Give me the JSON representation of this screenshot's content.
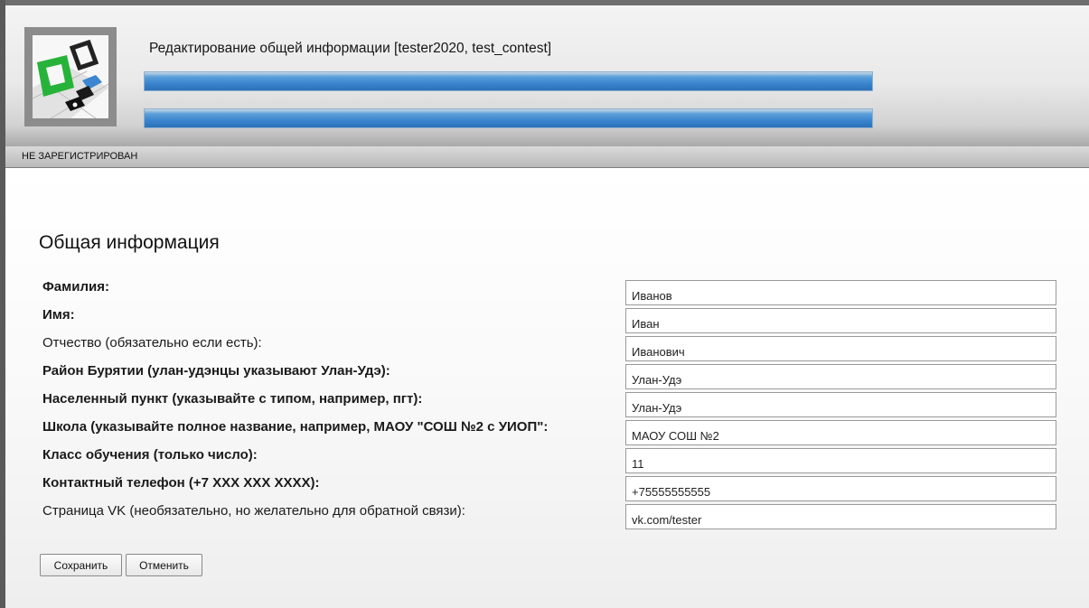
{
  "header": {
    "title": "Редактирование общей информации [tester2020, test_contest]",
    "accent_color": "#3c86cf"
  },
  "status": {
    "text": "НЕ ЗАРЕГИСТРИРОВАН"
  },
  "form": {
    "section_title": "Общая информация",
    "fields": [
      {
        "label": "Фамилия:",
        "value": "Иванов",
        "required": true
      },
      {
        "label": "Имя:",
        "value": "Иван",
        "required": true
      },
      {
        "label": "Отчество (обязательно если есть):",
        "value": "Иванович",
        "required": false
      },
      {
        "label": "Район Бурятии (улан-удэнцы указывают Улан-Удэ):",
        "value": "Улан-Удэ",
        "required": true
      },
      {
        "label": "Населенный пункт (указывайте с типом, например, пгт):",
        "value": "Улан-Удэ",
        "required": true
      },
      {
        "label": "Школа (указывайте полное название, например, МАОУ \"СОШ №2 с УИОП\":",
        "value": "МАОУ СОШ №2",
        "required": true
      },
      {
        "label": "Класс обучения (только число):",
        "value": "11",
        "required": true
      },
      {
        "label": "Контактный телефон (+7 XXX XXX XXXX):",
        "value": "+75555555555",
        "required": true
      },
      {
        "label": "Страница VK (необязательно, но желательно для обратной связи):",
        "value": "vk.com/tester",
        "required": false
      }
    ],
    "save_label": "Сохранить",
    "cancel_label": "Отменить"
  }
}
